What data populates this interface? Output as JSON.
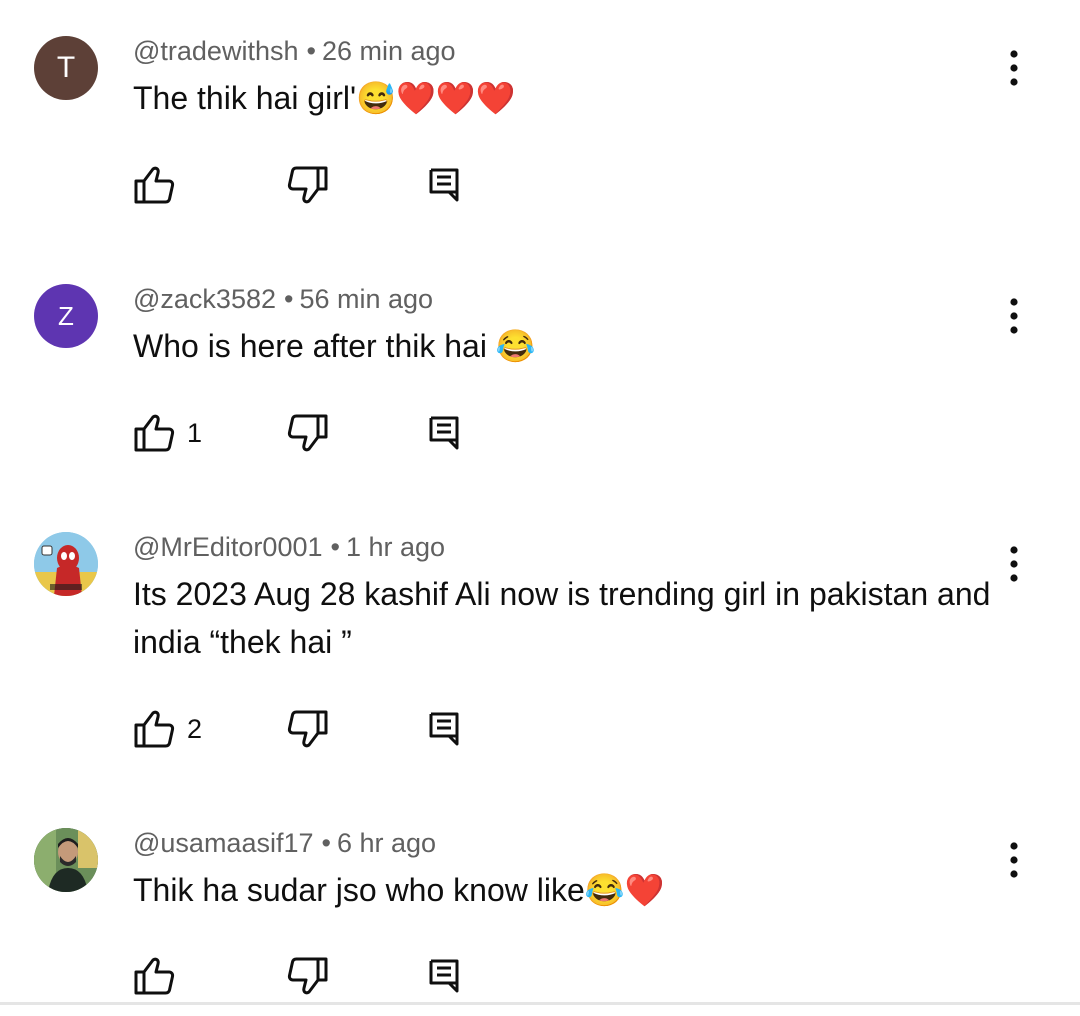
{
  "comments": [
    {
      "avatar_initial": "T",
      "avatar_color": "#5d4037",
      "username": "@tradewithsh",
      "time": "26 min ago",
      "text": "The thik hai girl'😅❤️❤️❤️",
      "likes": ""
    },
    {
      "avatar_initial": "Z",
      "avatar_color": "#5e35b1",
      "username": "@zack3582",
      "time": "56 min ago",
      "text": "Who is here after thik hai 😂",
      "likes": "1"
    },
    {
      "avatar_initial": "",
      "avatar_color": "#8ec9e8",
      "username": "@MrEditor0001",
      "time": "1 hr ago",
      "text": "Its 2023 Aug 28 kashif Ali now is trending girl in pakistan and india “thek hai ”",
      "likes": "2"
    },
    {
      "avatar_initial": "",
      "avatar_color": "#3e5b3a",
      "username": "@usamaasif17",
      "time": "6 hr ago",
      "text": "Thik ha sudar jso who know like😂❤️",
      "likes": ""
    }
  ],
  "icons": {
    "like": "thumb-up-icon",
    "dislike": "thumb-down-icon",
    "reply": "reply-comment-icon",
    "menu": "more-vertical-icon"
  },
  "colors": {
    "meta_text": "#606060",
    "body_text": "#0f0f0f"
  }
}
